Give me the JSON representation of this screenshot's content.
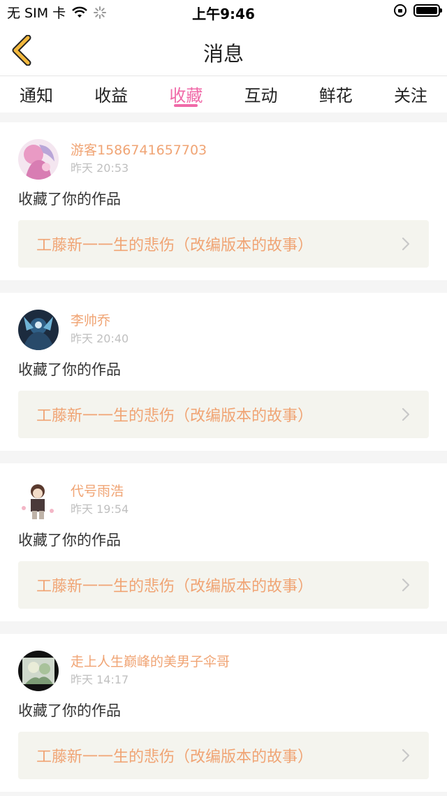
{
  "status_bar": {
    "carrier": "无 SIM 卡",
    "time": "上午9:46"
  },
  "nav": {
    "title": "消息",
    "back_icon": "chevron-left-icon",
    "back_color": "#f2b83d"
  },
  "tabs": [
    {
      "label": "通知",
      "active": false
    },
    {
      "label": "收益",
      "active": false
    },
    {
      "label": "收藏",
      "active": true
    },
    {
      "label": "互动",
      "active": false
    },
    {
      "label": "鲜花",
      "active": false
    },
    {
      "label": "关注",
      "active": false
    }
  ],
  "accent_color": "#f06aa8",
  "name_color": "#f0a474",
  "items": [
    {
      "username": "游客1586741657703",
      "time": "昨天 20:53",
      "action": "收藏了你的作品",
      "work_title": "工藤新一一生的悲伤（改编版本的故事）"
    },
    {
      "username": "李帅乔",
      "time": "昨天 20:40",
      "action": "收藏了你的作品",
      "work_title": "工藤新一一生的悲伤（改编版本的故事）"
    },
    {
      "username": "代号雨浩",
      "time": "昨天 19:54",
      "action": "收藏了你的作品",
      "work_title": "工藤新一一生的悲伤（改编版本的故事）"
    },
    {
      "username": "走上人生巅峰的美男子伞哥",
      "time": "昨天 14:17",
      "action": "收藏了你的作品",
      "work_title": "工藤新一一生的悲伤（改编版本的故事）"
    }
  ]
}
